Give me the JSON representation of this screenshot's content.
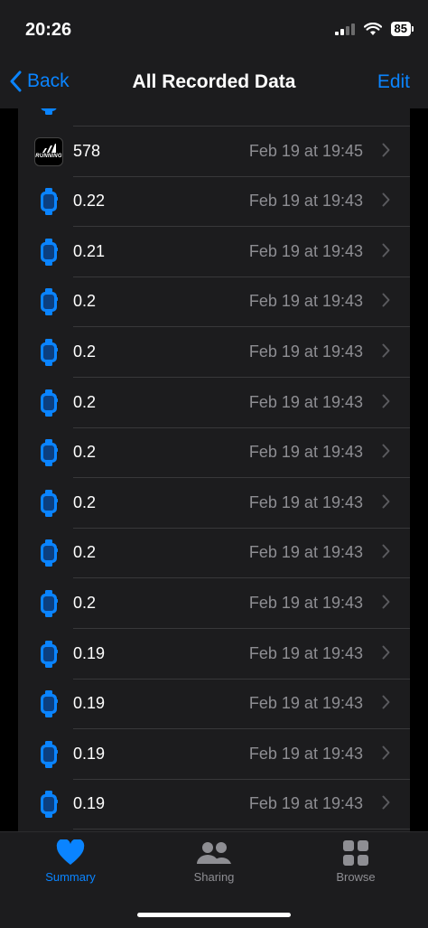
{
  "status": {
    "time": "20:26",
    "battery": "85"
  },
  "nav": {
    "back_label": "Back",
    "title": "All Recorded Data",
    "edit_label": "Edit"
  },
  "app_icon_label": "RUNNING",
  "rows": [
    {
      "icon": "watch-icon",
      "value": "",
      "date": ""
    },
    {
      "icon": "running-app-icon",
      "value": "578",
      "date": "Feb 19 at 19:45"
    },
    {
      "icon": "watch-icon",
      "value": "0.22",
      "date": "Feb 19 at 19:43"
    },
    {
      "icon": "watch-icon",
      "value": "0.21",
      "date": "Feb 19 at 19:43"
    },
    {
      "icon": "watch-icon",
      "value": "0.2",
      "date": "Feb 19 at 19:43"
    },
    {
      "icon": "watch-icon",
      "value": "0.2",
      "date": "Feb 19 at 19:43"
    },
    {
      "icon": "watch-icon",
      "value": "0.2",
      "date": "Feb 19 at 19:43"
    },
    {
      "icon": "watch-icon",
      "value": "0.2",
      "date": "Feb 19 at 19:43"
    },
    {
      "icon": "watch-icon",
      "value": "0.2",
      "date": "Feb 19 at 19:43"
    },
    {
      "icon": "watch-icon",
      "value": "0.2",
      "date": "Feb 19 at 19:43"
    },
    {
      "icon": "watch-icon",
      "value": "0.2",
      "date": "Feb 19 at 19:43"
    },
    {
      "icon": "watch-icon",
      "value": "0.19",
      "date": "Feb 19 at 19:43"
    },
    {
      "icon": "watch-icon",
      "value": "0.19",
      "date": "Feb 19 at 19:43"
    },
    {
      "icon": "watch-icon",
      "value": "0.19",
      "date": "Feb 19 at 19:43"
    },
    {
      "icon": "watch-icon",
      "value": "0.19",
      "date": "Feb 19 at 19:43"
    }
  ],
  "tabs": {
    "summary": "Summary",
    "sharing": "Sharing",
    "browse": "Browse"
  },
  "colors": {
    "accent": "#0a84ff",
    "background": "#1c1c1e",
    "secondary_text": "#8e8e93"
  }
}
